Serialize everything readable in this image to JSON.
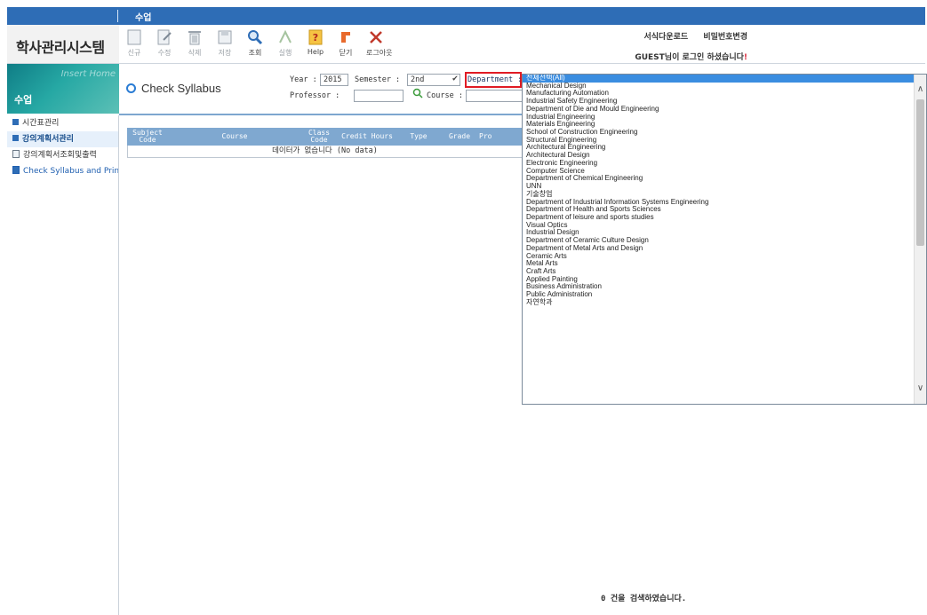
{
  "topbar": {
    "title": "수업"
  },
  "logo": {
    "text": "학사관리시스템"
  },
  "toolbar": {
    "buttons": [
      {
        "label": "신규",
        "icon": "new-doc-icon"
      },
      {
        "label": "수정",
        "icon": "edit-icon"
      },
      {
        "label": "삭제",
        "icon": "trash-icon"
      },
      {
        "label": "저장",
        "icon": "save-icon"
      },
      {
        "label": "조회",
        "icon": "search-icon"
      },
      {
        "label": "실행",
        "icon": "run-icon"
      },
      {
        "label": "Help",
        "icon": "help-icon"
      },
      {
        "label": "닫기",
        "icon": "close-icon"
      },
      {
        "label": "로그아웃",
        "icon": "logout-icon"
      }
    ],
    "links": [
      "서식다운로드",
      "비밀번호변경"
    ],
    "welcome_prefix": "GUEST님이 로그인 하셨습니다",
    "welcome_mark": "!"
  },
  "side_header": {
    "module": "수업",
    "deco": "Insert Home"
  },
  "nav": {
    "items": [
      {
        "label": "시간표관리"
      },
      {
        "label": "강의계획서관리"
      },
      {
        "label": "강의계획서조회및출력"
      },
      {
        "label": "Check Syllabus and Print"
      }
    ]
  },
  "panel": {
    "title": "Check Syllabus"
  },
  "search": {
    "year_label": "Year :",
    "year_value": "2015",
    "semester_label": "Semester :",
    "semester_value": "2nd",
    "department_label": "Department :",
    "professor_label": "Professor :",
    "course_label": "Course :"
  },
  "table": {
    "headers": [
      "Subject Code",
      "Course",
      "Class Code",
      "Credit Hours",
      "Type",
      "Grade",
      "Pro"
    ],
    "empty_text": "데이터가 없습니다 (No data)"
  },
  "department_options": [
    "전체선택(All)",
    "Mechanical Design",
    "Manufacturing Automation",
    "Industrial Safety Engineering",
    "Department of Die and Mould Engineering",
    "Industrial Engineering",
    "Materials Engineering",
    "School of Construction Engineering",
    "Structural Engineering",
    "Architectural Engineering",
    "Architectural Design",
    "Electronic Engineering",
    "Computer Science",
    "Department of Chemical Engineering",
    "UNN",
    "기술창업",
    "Department of Industrial Information Systems Engineering",
    "Department of Health and Sports Sciences",
    "Department of leisure and sports studies",
    "Visual Optics",
    "Industrial Design",
    "Department of Ceramic Culture Design",
    "Department of Metal Arts and Design",
    "Ceramic Arts",
    "Metal Arts",
    "Craft Arts",
    "Applied Painting",
    "Business Administration",
    "Public Administration",
    "자연학과"
  ],
  "footer": {
    "count_text": "0 건을 검색하였습니다."
  },
  "colors": {
    "brand_blue": "#2e6db6",
    "header_blue": "#7fa8d0",
    "highlight_red": "#e01b24",
    "select_blue": "#3a8de0"
  }
}
